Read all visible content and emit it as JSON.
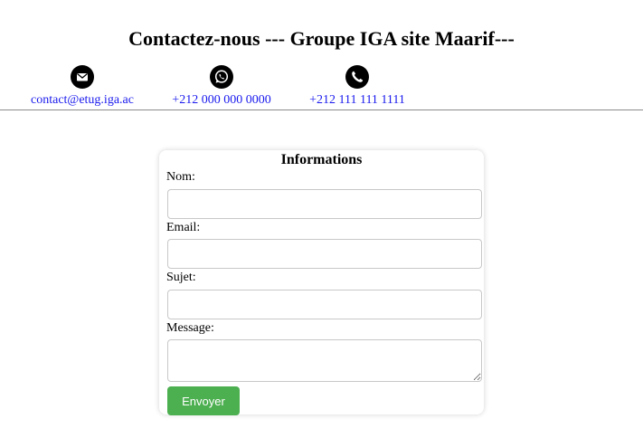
{
  "header": {
    "title": "Contactez-nous --- Groupe IGA site Maarif---"
  },
  "contacts": [
    {
      "icon": "envelope-icon",
      "label": "contact@etug.iga.ac"
    },
    {
      "icon": "whatsapp-icon",
      "label": "+212 000 000 0000"
    },
    {
      "icon": "phone-icon",
      "label": "+212 111 111 1111"
    }
  ],
  "form": {
    "title": "Informations",
    "fields": [
      {
        "label": "Nom:",
        "value": ""
      },
      {
        "label": "Email:",
        "value": ""
      },
      {
        "label": "Sujet:",
        "value": ""
      },
      {
        "label": "Message:",
        "value": ""
      }
    ],
    "submit_label": "Envoyer"
  },
  "colors": {
    "link": "#1a1aee",
    "submit": "#4caf50",
    "icon_bg": "#000000"
  }
}
